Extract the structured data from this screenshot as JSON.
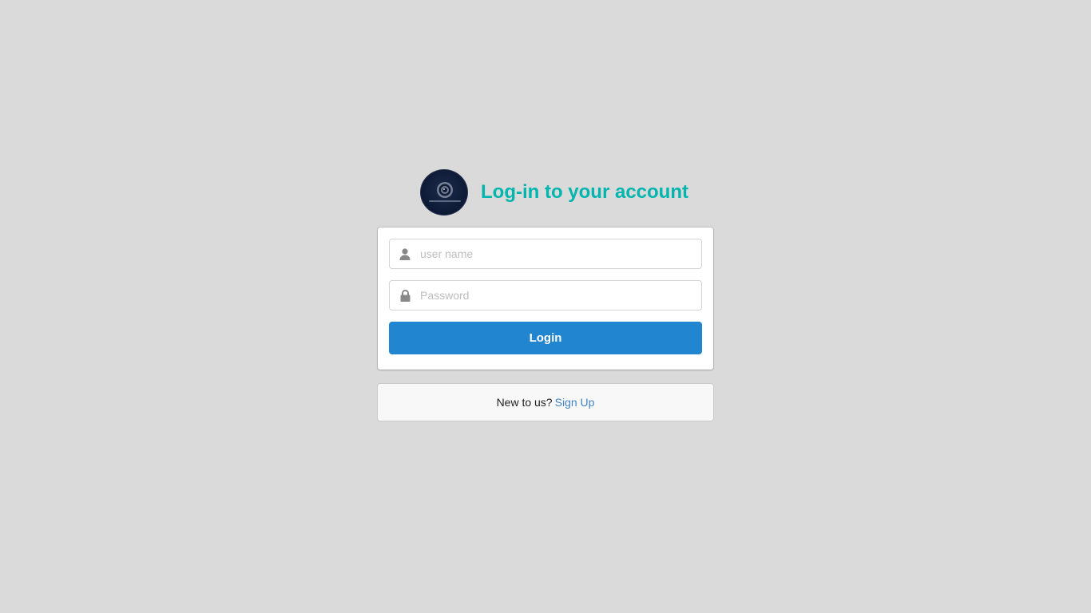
{
  "header": {
    "title": "Log-in to your account",
    "logo_icon": "camera-lens-logo"
  },
  "form": {
    "username": {
      "placeholder": "user name",
      "value": "",
      "icon": "user-icon"
    },
    "password": {
      "placeholder": "Password",
      "value": "",
      "icon": "lock-icon"
    },
    "login_label": "Login"
  },
  "signup": {
    "prompt": "New to us?",
    "link_label": "Sign Up"
  },
  "colors": {
    "background": "#dadada",
    "title": "#00b5ad",
    "button": "#2185d0",
    "link": "#4183c4",
    "icon": "#888888"
  }
}
